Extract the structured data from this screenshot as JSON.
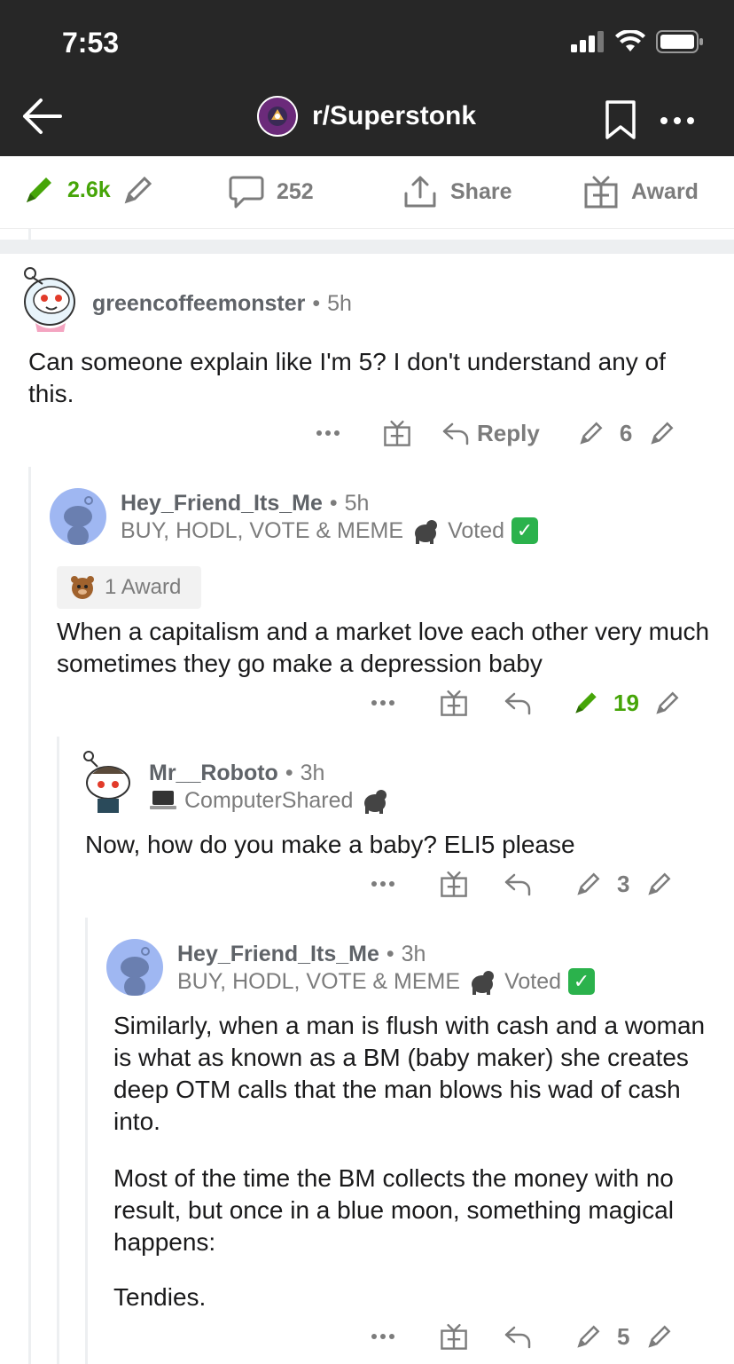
{
  "status_bar": {
    "time": "7:53"
  },
  "nav": {
    "subreddit": "r/Superstonk"
  },
  "post_actions": {
    "votes": "2.6k",
    "comments": "252",
    "share": "Share",
    "award": "Award"
  },
  "comments": [
    {
      "username": "greencoffeemonster",
      "age": "5h",
      "body": "Can someone explain like I'm 5? I don't understand any of this.",
      "reply": "Reply",
      "score": "6"
    },
    {
      "username": "Hey_Friend_Its_Me",
      "age": "5h",
      "flair": "BUY, HODL, VOTE & MEME",
      "flair_voted": "Voted",
      "award": "1 Award",
      "body": "When a capitalism and a market love each other very much sometimes they go make a depression baby",
      "score": "19",
      "score_color": "#46a508"
    },
    {
      "username": "Mr__Roboto",
      "age": "3h",
      "flair": "ComputerShared",
      "body": "Now, how do you make a baby? ELI5 please",
      "score": "3"
    },
    {
      "username": "Hey_Friend_Its_Me",
      "age": "3h",
      "flair": "BUY, HODL, VOTE & MEME",
      "flair_voted": "Voted",
      "body_p1": "Similarly, when a man is flush with cash and a woman is what as known as a BM (baby maker) she creates deep OTM calls that the man blows his wad of cash into.",
      "body_p2": "Most of the time the BM collects the money with no result, but once in a blue moon, something magical happens:",
      "body_p3": "Tendies.",
      "score": "5"
    }
  ],
  "colors": {
    "upvote_green": "#46a508",
    "header_bg": "#272727",
    "meta_gray": "#7c7c7c"
  }
}
